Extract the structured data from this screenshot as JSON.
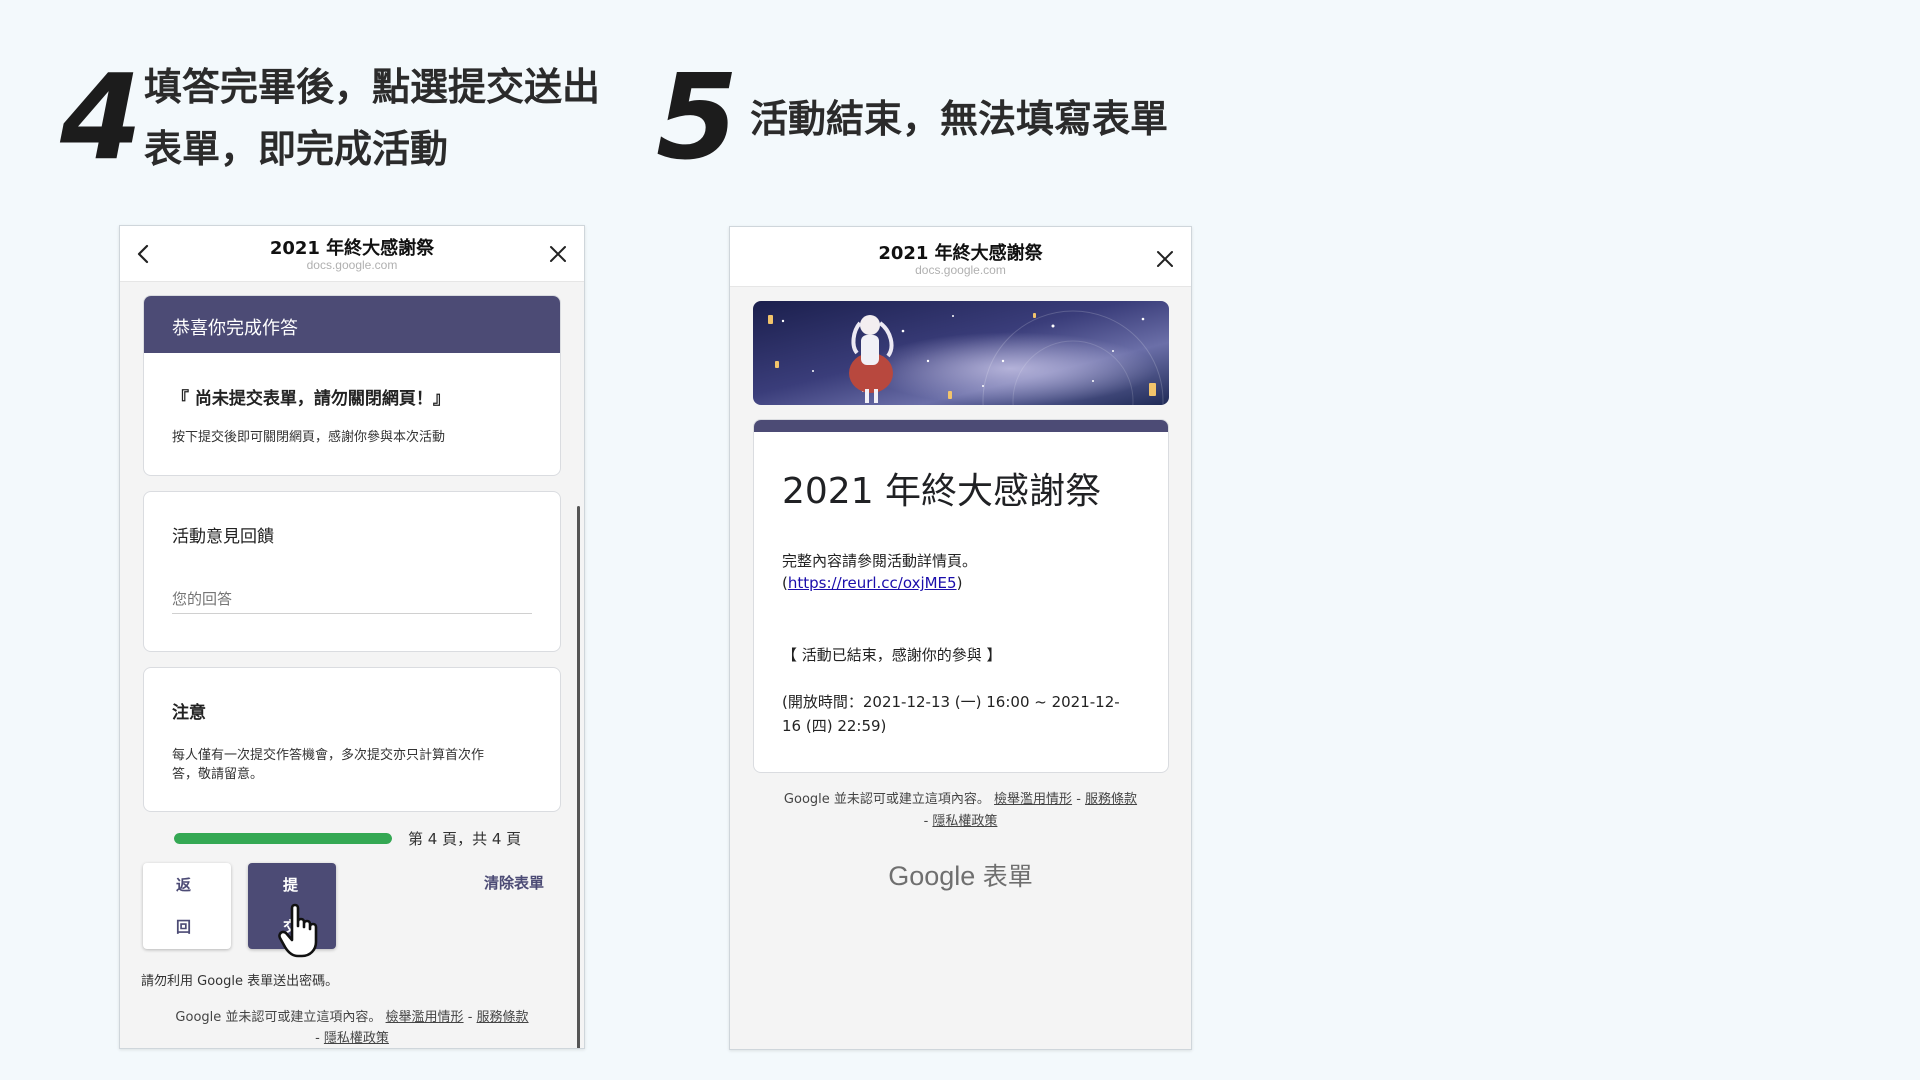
{
  "step4": {
    "number": "4",
    "line1": "填答完畢後，點選提交送出",
    "line2": "表單，即完成活動"
  },
  "step5": {
    "number": "5",
    "text": "活動結束，無法填寫表單"
  },
  "phone_left": {
    "header": {
      "title": "2021 年終大感謝祭",
      "url": "docs.google.com"
    },
    "congrats_card": {
      "header": "恭喜你完成作答",
      "warning": "『 尚未提交表單，請勿關閉網頁！』",
      "note": "按下提交後即可關閉網頁，感謝你參與本次活動"
    },
    "feedback_card": {
      "question": "活動意見回饋",
      "placeholder": "您的回答"
    },
    "notice_card": {
      "title": "注意",
      "line1": "每人僅有一次提交作答機會，多次提交亦只計算首次作",
      "line2": "答，敬請留意。"
    },
    "progress": {
      "label": "第 4 頁，共 4 頁",
      "fraction": 1.0,
      "color": "#34a853"
    },
    "buttons": {
      "back_1": "返",
      "back_2": "回",
      "submit_1": "提",
      "submit_2": "交",
      "clear": "清除表單"
    },
    "password_warning": "請勿利用 Google 表單送出密碼。",
    "footer": {
      "disclaimer": "Google 並未認可或建立這項內容。",
      "report": "檢舉濫用情形",
      "sep1": "-",
      "terms": "服務條款",
      "sep2": "-",
      "privacy": "隱私權政策"
    }
  },
  "phone_right": {
    "header": {
      "title": "2021 年終大感謝祭",
      "url": "docs.google.com"
    },
    "form": {
      "title": "2021 年終大感謝祭",
      "desc": "完整內容請參閱活動詳情頁。",
      "link_open": "(",
      "link": "https://reurl.cc/oxjME5",
      "link_close": ")",
      "ended": "【 活動已結束，感謝你的參與 】",
      "time_line1": "(開放時間：2021-12-13 (一) 16:00 ~ 2021-12-",
      "time_line2": "16 (四) 22:59)"
    },
    "footer": {
      "disclaimer": "Google 並未認可或建立這項內容。",
      "report": "檢舉濫用情形",
      "sep1": "-",
      "terms": "服務條款",
      "sep2": "-",
      "privacy": "隱私權政策"
    },
    "brand": {
      "google": "Google",
      "forms": "表單"
    }
  },
  "colors": {
    "page_bg": "#f3f9fc",
    "accent": "#4c4b75",
    "progress": "#34a853",
    "link": "#1a0dab"
  }
}
